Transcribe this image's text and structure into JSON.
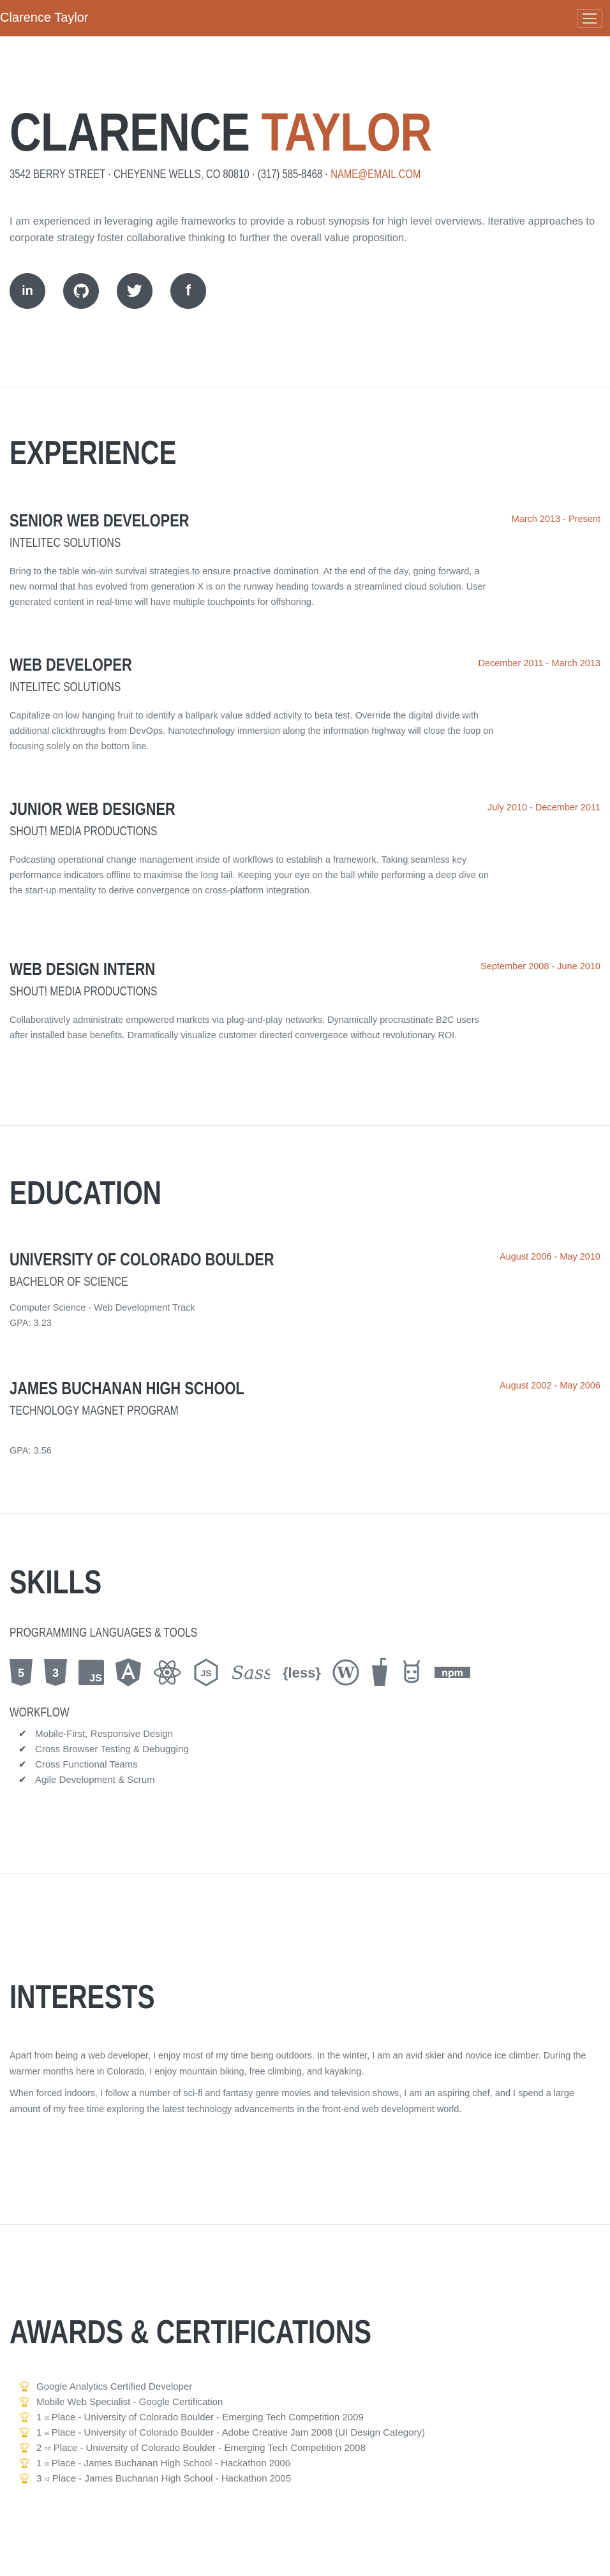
{
  "navbar": {
    "brand": "Clarence Taylor",
    "toggle_icon": "menu-icon"
  },
  "about": {
    "first_name": "Clarence",
    "last_name": "Taylor",
    "contact": "3542 Berry Street · Cheyenne Wells, CO 80810 · (317) 585-8468 ·",
    "email": "name@email.com",
    "lead": "I am experienced in leveraging agile frameworks to provide a robust synopsis for high level overviews. Iterative approaches to corporate strategy foster collaborative thinking to further the overall value proposition.",
    "socials": [
      {
        "icon": "linkedin-icon",
        "glyph": "in"
      },
      {
        "icon": "github-icon",
        "glyph": "GH"
      },
      {
        "icon": "twitter-icon",
        "glyph": "tw"
      },
      {
        "icon": "facebook-icon",
        "glyph": "f"
      }
    ]
  },
  "experience": {
    "heading": "Experience",
    "items": [
      {
        "title": "Senior Web Developer",
        "company": "Intelitec Solutions",
        "dates": "March 2013 - Present",
        "text": "Bring to the table win-win survival strategies to ensure proactive domination. At the end of the day, going forward, a new normal that has evolved from generation X is on the runway heading towards a streamlined cloud solution. User generated content in real-time will have multiple touchpoints for offshoring."
      },
      {
        "title": "Web Developer",
        "company": "Intelitec Solutions",
        "dates": "December 2011 - March 2013",
        "text": "Capitalize on low hanging fruit to identify a ballpark value added activity to beta test. Override the digital divide with additional clickthroughs from DevOps. Nanotechnology immersion along the information highway will close the loop on focusing solely on the bottom line."
      },
      {
        "title": "Junior Web Designer",
        "company": "Shout! Media Productions",
        "dates": "July 2010 - December 2011",
        "text": "Podcasting operational change management inside of workflows to establish a framework. Taking seamless key performance indicators offline to maximise the long tail. Keeping your eye on the ball while performing a deep dive on the start-up mentality to derive convergence on cross-platform integration."
      },
      {
        "title": "Web Design Intern",
        "company": "Shout! Media Productions",
        "dates": "September 2008 - June 2010",
        "text": "Collaboratively administrate empowered markets via plug-and-play networks. Dynamically procrastinate B2C users after installed base benefits. Dramatically visualize customer directed convergence without revolutionary ROI."
      }
    ]
  },
  "education": {
    "heading": "Education",
    "items": [
      {
        "title": "University of Colorado Boulder",
        "degree": "Bachelor of Science",
        "dates": "August 2006 - May 2010",
        "line1": "Computer Science - Web Development Track",
        "line2": "GPA: 3.23"
      },
      {
        "title": "James Buchanan High School",
        "degree": "Technology Magnet Program",
        "dates": "August 2002 - May 2006",
        "line1": "GPA: 3.56"
      }
    ]
  },
  "skills": {
    "heading": "Skills",
    "languages_heading": "Programming Languages & Tools",
    "icons": [
      "html5-icon",
      "css3-icon",
      "js-square-icon",
      "angular-icon",
      "react-icon",
      "node-js-icon",
      "sass-icon",
      "less-icon",
      "wordpress-icon",
      "gulp-icon",
      "grunt-icon",
      "npm-icon"
    ],
    "workflow_heading": "Workflow",
    "workflow": [
      "Mobile-First, Responsive Design",
      "Cross Browser Testing & Debugging",
      "Cross Functional Teams",
      "Agile Development & Scrum"
    ]
  },
  "interests": {
    "heading": "Interests",
    "p1": "Apart from being a web developer, I enjoy most of my time being outdoors. In the winter, I am an avid skier and novice ice climber. During the warmer months here in Colorado, I enjoy mountain biking, free climbing, and kayaking.",
    "p2": "When forced indoors, I follow a number of sci-fi and fantasy genre movies and television shows, I am an aspiring chef, and I spend a large amount of my free time exploring the latest technology advancements in the front-end web development world."
  },
  "awards": {
    "heading": "Awards & Certifications",
    "items": [
      {
        "text": "Google Analytics Certified Developer"
      },
      {
        "text": "Mobile Web Specialist - Google Certification"
      },
      {
        "num": "1",
        "sup": "st",
        "text": "Place - University of Colorado Boulder - Emerging Tech Competition 2009"
      },
      {
        "num": "1",
        "sup": "st",
        "text": "Place - University of Colorado Boulder - Adobe Creative Jam 2008 (UI Design Category)"
      },
      {
        "num": "2",
        "sup": "nd",
        "text": "Place - University of Colorado Boulder - Emerging Tech Competition 2008"
      },
      {
        "num": "1",
        "sup": "st",
        "text": "Place - James Buchanan High School - Hackathon 2006"
      },
      {
        "num": "3",
        "sup": "rd",
        "text": "Place - James Buchanan High School - Hackathon 2005"
      }
    ]
  }
}
